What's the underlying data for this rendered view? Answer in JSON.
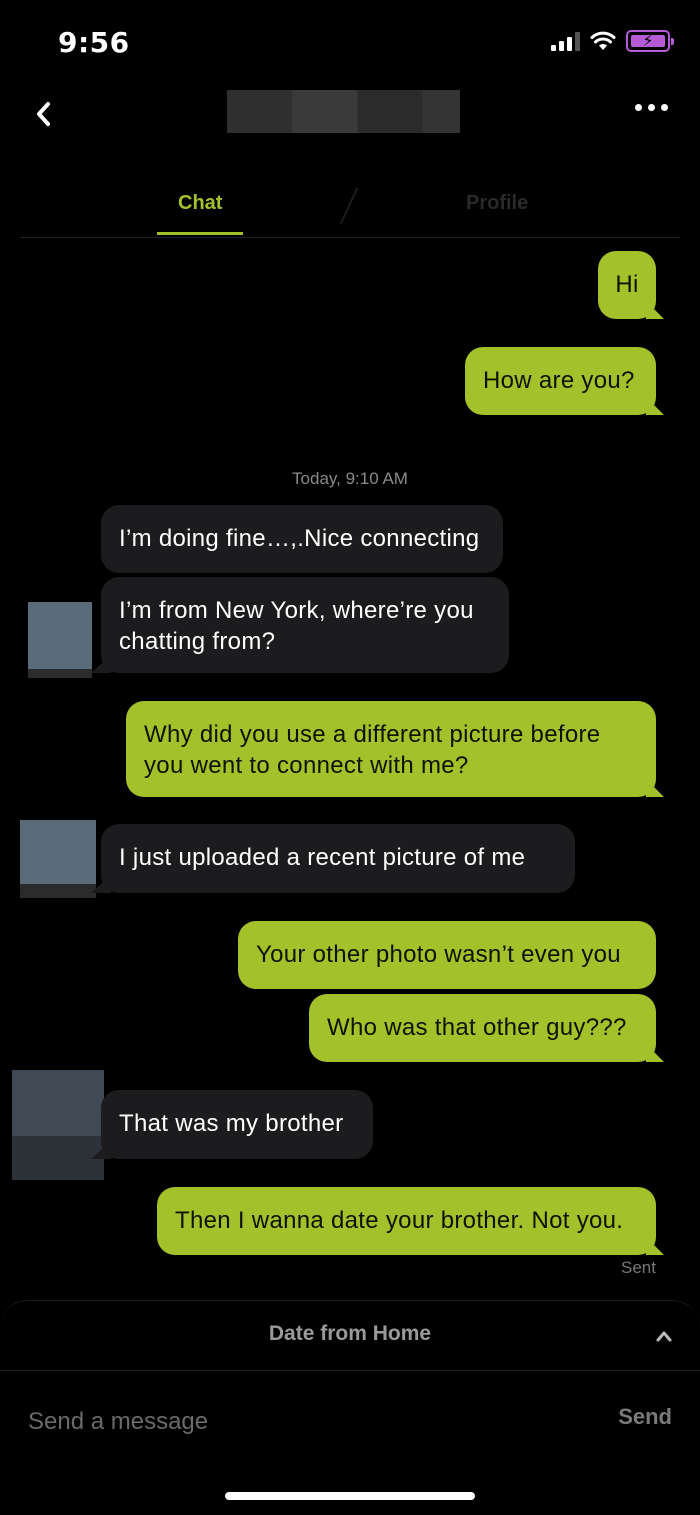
{
  "status_bar": {
    "time": "9:56",
    "battery_bolt": "⚡"
  },
  "header": {
    "back_icon": "chevron-left-icon",
    "more_icon": "ellipsis-icon"
  },
  "tabs": [
    {
      "label": "Chat",
      "active": true
    },
    {
      "label": "Profile",
      "active": false
    }
  ],
  "conversation": {
    "timestamp": "Today, 9:10 AM",
    "messages": [
      {
        "from": "me",
        "text": "Hi"
      },
      {
        "from": "me",
        "text": "How are you?"
      },
      {
        "from": "them",
        "text": "I’m doing fine…,.Nice connecting"
      },
      {
        "from": "them",
        "text": "I’m from New York, where’re you chatting from?"
      },
      {
        "from": "me",
        "text": "Why did you use a different picture before you went to connect with me?"
      },
      {
        "from": "them",
        "text": "I just uploaded a recent picture of me"
      },
      {
        "from": "me",
        "text": "Your other photo wasn’t even you"
      },
      {
        "from": "me",
        "text": "Who was that other guy???"
      },
      {
        "from": "them",
        "text": "That was my brother"
      },
      {
        "from": "me",
        "text": "Then I wanna date your brother. Not you."
      }
    ],
    "sent_label": "Sent"
  },
  "bottom_panel": {
    "title": "Date from Home",
    "input_placeholder": "Send a message",
    "send_label": "Send"
  },
  "colors": {
    "accent": "#a3c12b",
    "background": "#000000",
    "incoming_bubble": "#1c1c1e"
  }
}
